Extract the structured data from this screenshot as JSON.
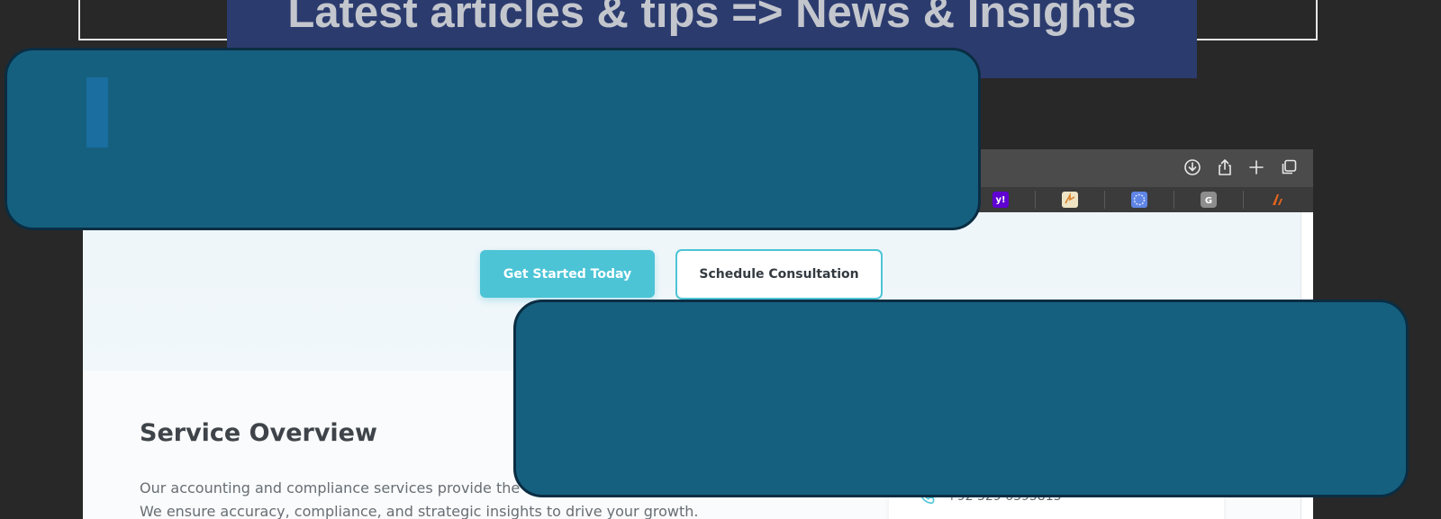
{
  "overlay_heading": "Latest articles & tips => News & Insights",
  "browser": {
    "toolbar_icons": [
      "download-icon",
      "share-icon",
      "new-tab-icon",
      "tab-overview-icon"
    ],
    "bookmarks": [
      {
        "name": "yahoo-icon",
        "glyph": "y!",
        "color": "#5f01d1"
      },
      {
        "name": "bookmark-icon-2",
        "glyph": "",
        "color": "#e8d9b0"
      },
      {
        "name": "bookmark-icon-3",
        "glyph": "",
        "color": "#8aa8f0"
      },
      {
        "name": "bookmark-icon-4",
        "glyph": "G",
        "color": "#8c8c8c"
      },
      {
        "name": "bookmark-icon-5",
        "glyph": "",
        "color": "#e0601d"
      }
    ]
  },
  "hero": {
    "primary_button": "Get Started Today",
    "secondary_button": "Schedule Consultation"
  },
  "service": {
    "title": "Service Overview",
    "line1": "Our accounting and compliance services provide the fou",
    "line2": "We ensure accuracy, compliance, and strategic insights to drive your growth."
  },
  "contact": {
    "phone": "+92 329 6395813"
  },
  "colors": {
    "accent": "#4cc4d6",
    "panel": "#16607f",
    "panel_border": "#0a2d43",
    "overlay_title_bg": "#2c3b6e"
  }
}
